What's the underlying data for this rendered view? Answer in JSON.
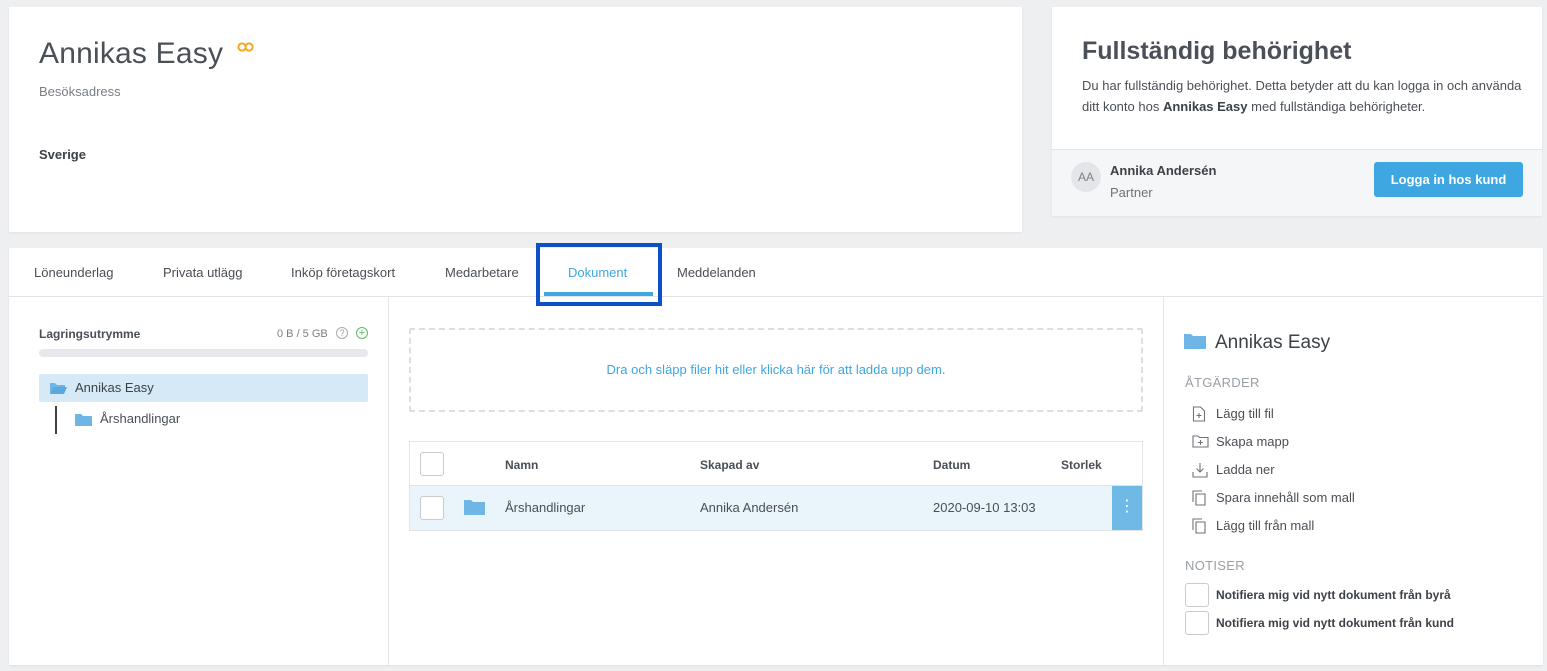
{
  "company": {
    "name": "Annikas Easy",
    "address_label": "Besöksadress",
    "country": "Sverige"
  },
  "permission": {
    "title": "Fullständig behörighet",
    "desc_pre": "Du har fullständig behörighet. Detta betyder att du kan logga in och använda ditt konto hos ",
    "desc_company": "Annikas Easy",
    "desc_post": " med fullständiga behörigheter.",
    "avatar_initials": "AA",
    "partner_name": "Annika Andersén",
    "partner_role": "Partner",
    "login_label": "Logga in hos kund"
  },
  "tabs": [
    {
      "label": "Löneunderlag"
    },
    {
      "label": "Privata utlägg"
    },
    {
      "label": "Inköp företagskort"
    },
    {
      "label": "Medarbetare"
    },
    {
      "label": "Dokument",
      "active": true
    },
    {
      "label": "Meddelanden"
    }
  ],
  "storage": {
    "label": "Lagringsutrymme",
    "usage": "0 B / 5 GB",
    "used_fraction": 0
  },
  "tree": {
    "root": "Annikas Easy",
    "children": [
      "Årshandlingar"
    ]
  },
  "dropzone": {
    "text": "Dra och släpp filer hit eller klicka här för att ladda upp dem."
  },
  "table": {
    "headers": {
      "name": "Namn",
      "created_by": "Skapad av",
      "date": "Datum",
      "size": "Storlek"
    },
    "rows": [
      {
        "name": "Årshandlingar",
        "created_by": "Annika Andersén",
        "date": "2020-09-10 13:03",
        "size": ""
      }
    ],
    "row_menu_icon": "⋮"
  },
  "details": {
    "title": "Annikas Easy",
    "actions_heading": "ÅTGÄRDER",
    "actions": [
      {
        "label": "Lägg till fil",
        "icon": "add-file-icon"
      },
      {
        "label": "Skapa mapp",
        "icon": "add-folder-icon"
      },
      {
        "label": "Ladda ner",
        "icon": "download-icon"
      },
      {
        "label": "Spara innehåll som mall",
        "icon": "copy-icon"
      },
      {
        "label": "Lägg till från mall",
        "icon": "copy-icon"
      }
    ],
    "notify_heading": "NOTISER",
    "notifications": [
      {
        "label": "Notifiera mig vid nytt dokument från byrå",
        "checked": false
      },
      {
        "label": "Notifiera mig vid nytt dokument från kund",
        "checked": false
      }
    ]
  },
  "colors": {
    "accent": "#3ea7e2",
    "highlight_frame": "#0d4fc7",
    "folder": "#6db6e6",
    "badge": "#f5a623"
  }
}
